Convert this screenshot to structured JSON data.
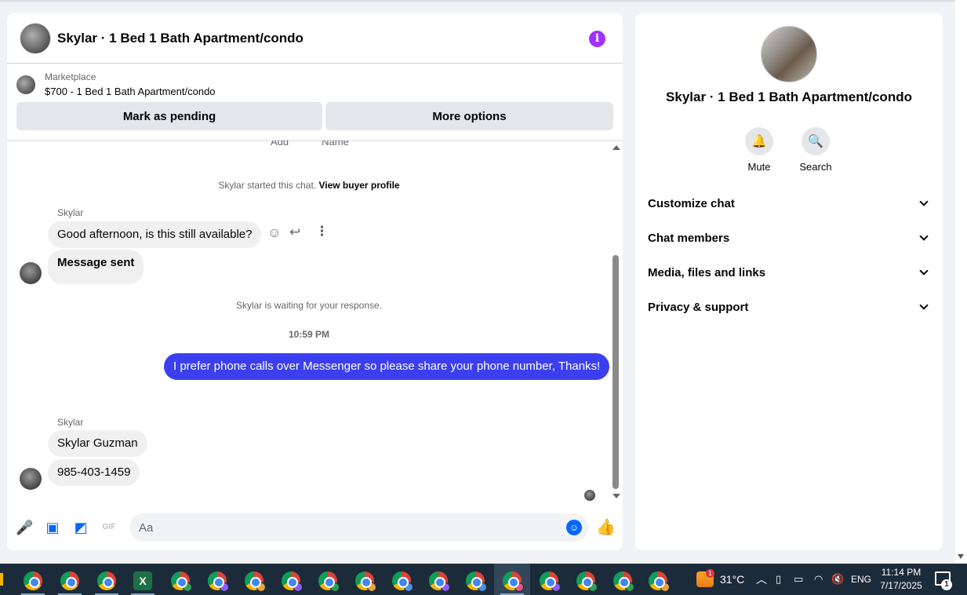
{
  "chat": {
    "title": "Skylar · 1 Bed 1 Bath Apartment/condo",
    "info_icon": "i",
    "marketplace": {
      "label": "Marketplace",
      "item": "$700 - 1 Bed 1 Bath Apartment/condo",
      "mark_pending_label": "Mark as pending",
      "more_options_label": "More options"
    },
    "cutoff_labels": [
      "Add",
      "Name"
    ],
    "system_started": "Skylar started this chat.",
    "view_buyer_profile": "View buyer profile",
    "system_waiting": "Skylar is waiting for your response.",
    "timestamp": "10:59 PM",
    "messages": [
      {
        "sender": "Skylar",
        "text": "Good afternoon, is this still available?"
      },
      {
        "sender": "",
        "text": "Message sent"
      },
      {
        "sender": "me",
        "text": "I prefer phone calls over Messenger so please share your phone number, Thanks!"
      },
      {
        "sender": "Skylar",
        "text": "Skylar Guzman"
      },
      {
        "sender": "",
        "text": "985-403-1459"
      }
    ],
    "composer": {
      "placeholder": "Aa",
      "gif_label": "GIF"
    }
  },
  "info_panel": {
    "title": "Skylar · 1 Bed 1 Bath Apartment/condo",
    "actions": [
      {
        "label": "Mute",
        "icon": "bell-icon"
      },
      {
        "label": "Search",
        "icon": "search-icon"
      }
    ],
    "sections": [
      {
        "label": "Customize chat"
      },
      {
        "label": "Chat members"
      },
      {
        "label": "Media, files and links"
      },
      {
        "label": "Privacy & support"
      }
    ]
  },
  "taskbar": {
    "weather": "31°C",
    "weather_badge": "1",
    "language": "ENG",
    "time": "11:14 PM",
    "date": "7/17/2025",
    "notification_count": "1"
  },
  "colors": {
    "accent": "#0866ff",
    "my_bubble": "#3b3ff0",
    "info_purple": "#a033ff",
    "taskbar": "#1c2b3a"
  }
}
